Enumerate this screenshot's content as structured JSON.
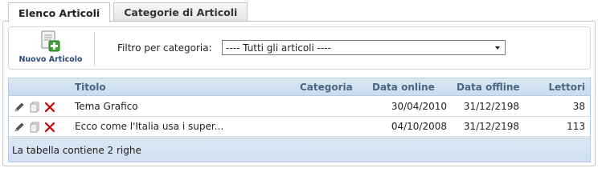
{
  "tabs": [
    {
      "label": "Elenco Articoli",
      "active": true
    },
    {
      "label": "Categorie di Articoli",
      "active": false
    }
  ],
  "toolbar": {
    "new_button_label": "Nuovo Articolo",
    "filter_label": "Filtro per categoria:",
    "filter_selected": "---- Tutti gli articoli ----"
  },
  "table": {
    "columns": [
      "Titolo",
      "Categoria",
      "Data online",
      "Data offline",
      "Lettori"
    ],
    "rows": [
      {
        "title": "Tema Grafico",
        "category": "",
        "date_online": "30/04/2010",
        "date_offline": "31/12/2198",
        "readers": "38"
      },
      {
        "title": "Ecco come l'Italia usa i super...",
        "category": "",
        "date_online": "04/10/2008",
        "date_offline": "31/12/2198",
        "readers": "113"
      }
    ],
    "footer": "La tabella contiene 2 righe"
  },
  "icons": {
    "edit": "pencil-icon",
    "copy": "copy-icon",
    "delete": "delete-x-icon",
    "new": "new-document-icon"
  },
  "colors": {
    "header_text": "#4a6683",
    "header_bg": "#c9dbee",
    "delete_red": "#cc0000",
    "plus_green": "#3ca634"
  }
}
